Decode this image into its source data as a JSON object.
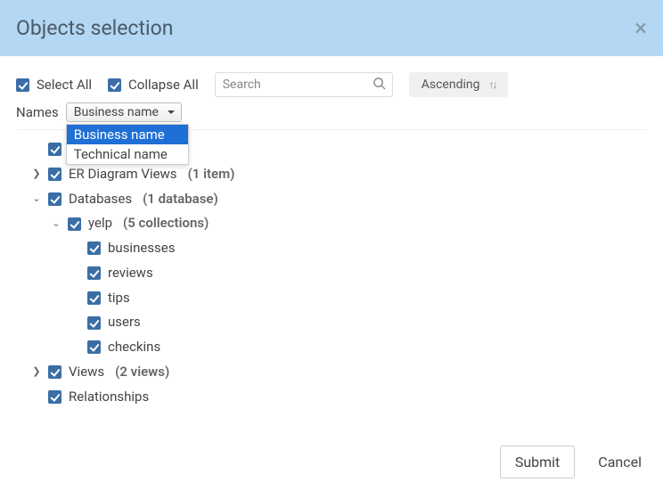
{
  "header": {
    "title": "Objects selection"
  },
  "controls": {
    "select_all_label": "Select All",
    "collapse_all_label": "Collapse All",
    "search_placeholder": "Search",
    "sort_label": "Ascending"
  },
  "names": {
    "label": "Names",
    "selected": "Business name",
    "options": [
      "Business name",
      "Technical name"
    ]
  },
  "tree": {
    "root_hidden_label": "",
    "er_views": {
      "label": "ER Diagram Views",
      "count": "(1 item)"
    },
    "databases": {
      "label": "Databases",
      "count": "(1 database)",
      "db": {
        "label": "yelp",
        "count": "(5 collections)",
        "cols": [
          "businesses",
          "reviews",
          "tips",
          "users",
          "checkins"
        ]
      }
    },
    "views": {
      "label": "Views",
      "count": "(2 views)"
    },
    "relationships": {
      "label": "Relationships"
    }
  },
  "footer": {
    "submit": "Submit",
    "cancel": "Cancel"
  }
}
